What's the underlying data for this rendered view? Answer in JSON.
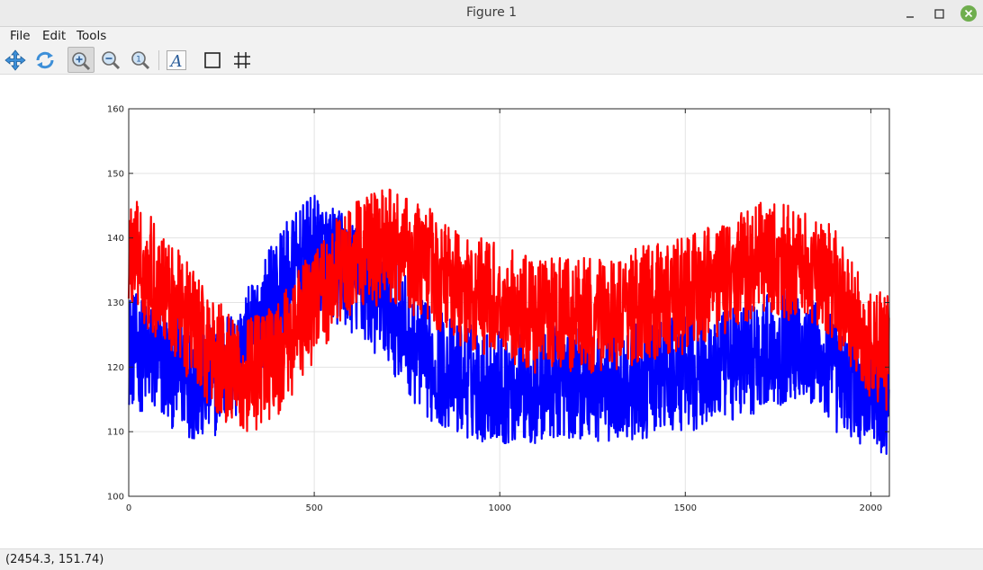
{
  "window": {
    "title": "Figure 1"
  },
  "menu": [
    "File",
    "Edit",
    "Tools"
  ],
  "toolbar": {
    "tools": [
      {
        "icon": "pan-icon",
        "active": false
      },
      {
        "icon": "rotate-icon",
        "active": false
      },
      {
        "icon": "zoom-in-icon",
        "active": true
      },
      {
        "icon": "zoom-out-icon",
        "active": false
      },
      {
        "icon": "zoom-reset-icon",
        "active": false
      },
      {
        "icon": "insert-text-icon",
        "active": false
      },
      {
        "icon": "toggle-box-icon",
        "active": false
      },
      {
        "icon": "toggle-grid-icon",
        "active": false
      }
    ]
  },
  "status": {
    "coordinates": "(2454.3, 151.74)"
  },
  "colors": {
    "series1": "#0000ff",
    "series2": "#ff0000",
    "close_button": "#6fae4e"
  },
  "chart_data": {
    "type": "line",
    "title": "",
    "xlabel": "",
    "ylabel": "",
    "xlim": [
      0,
      2050
    ],
    "ylim": [
      100,
      160
    ],
    "xticks": [
      0,
      500,
      1000,
      1500,
      2000
    ],
    "yticks": [
      100,
      110,
      120,
      130,
      140,
      150,
      160
    ],
    "grid": true,
    "box": true,
    "samples": 2050,
    "series": [
      {
        "color": "#0000ff",
        "noise_amplitude": 9,
        "trend": [
          [
            0,
            123
          ],
          [
            100,
            120
          ],
          [
            200,
            117
          ],
          [
            300,
            121
          ],
          [
            400,
            132
          ],
          [
            500,
            138
          ],
          [
            600,
            134
          ],
          [
            700,
            129
          ],
          [
            800,
            121
          ],
          [
            900,
            118
          ],
          [
            1000,
            117
          ],
          [
            1100,
            117
          ],
          [
            1200,
            118
          ],
          [
            1300,
            117
          ],
          [
            1400,
            118
          ],
          [
            1500,
            119
          ],
          [
            1600,
            120
          ],
          [
            1700,
            122
          ],
          [
            1800,
            124
          ],
          [
            1900,
            119
          ],
          [
            2000,
            116
          ],
          [
            2050,
            115
          ]
        ]
      },
      {
        "color": "#ff0000",
        "noise_amplitude": 9,
        "trend": [
          [
            0,
            138
          ],
          [
            100,
            132
          ],
          [
            200,
            124
          ],
          [
            300,
            118
          ],
          [
            400,
            121
          ],
          [
            500,
            130
          ],
          [
            600,
            137
          ],
          [
            700,
            139
          ],
          [
            800,
            136
          ],
          [
            900,
            132
          ],
          [
            1000,
            130
          ],
          [
            1100,
            128
          ],
          [
            1200,
            128
          ],
          [
            1300,
            128
          ],
          [
            1400,
            130
          ],
          [
            1500,
            131
          ],
          [
            1600,
            134
          ],
          [
            1700,
            137
          ],
          [
            1800,
            136
          ],
          [
            1900,
            133
          ],
          [
            2000,
            124
          ],
          [
            2050,
            122
          ]
        ]
      }
    ]
  }
}
